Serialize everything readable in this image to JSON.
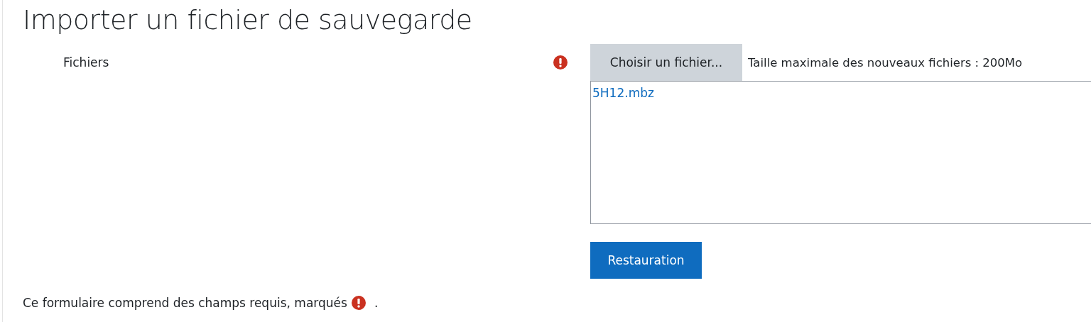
{
  "title": "Importer un fichier de sauvegarde",
  "field": {
    "label": "Fichiers",
    "required": true,
    "choose_button": "Choisir un fichier...",
    "max_size": "Taille maximale des nouveaux fichiers : 200Mo",
    "files": [
      "5H12.mbz"
    ]
  },
  "submit_button": "Restauration",
  "footer": {
    "text": "Ce formulaire comprend des champs requis, marqués",
    "after": "."
  }
}
